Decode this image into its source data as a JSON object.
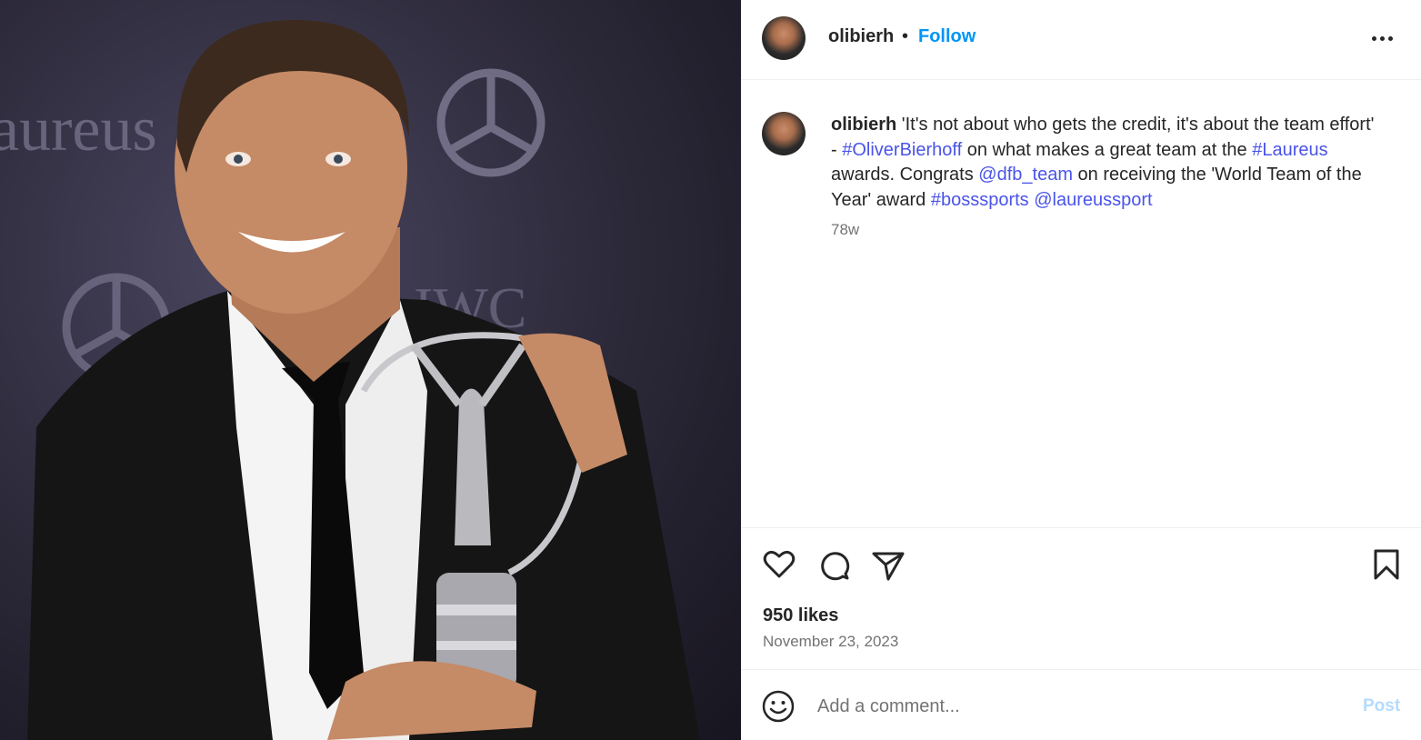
{
  "photo": {
    "description_icon": "award-photo",
    "backdrop_text": "aureus",
    "backdrop_brand": "IWC"
  },
  "header": {
    "username": "olibierh",
    "separator": "•",
    "follow_label": "Follow",
    "more_icon": "more-options-icon"
  },
  "caption": {
    "username": "olibierh",
    "text_1": " 'It's not about who gets the credit, it's about the team effort' - ",
    "tag_1": "#OliverBierhoff",
    "text_2": " on what makes a great team at the ",
    "tag_2": "#Laureus",
    "text_3": " awards. Congrats ",
    "mention_1": "@dfb_team",
    "text_4": " on receiving the 'World Team of the Year' award ",
    "tag_3": "#bosssports",
    "text_5": " ",
    "mention_2": "@laureussport",
    "time": "78w"
  },
  "actions": {
    "like_icon": "heart-icon",
    "comment_icon": "comment-icon",
    "share_icon": "share-icon",
    "save_icon": "bookmark-icon",
    "likes": "950 likes",
    "date": "November 23, 2023"
  },
  "comment": {
    "emoji_icon": "emoji-icon",
    "placeholder": "Add a comment...",
    "post_label": "Post"
  },
  "colors": {
    "link": "#4a54e8",
    "follow": "#0095f6",
    "post_disabled": "#b3dbff",
    "muted": "#737373"
  }
}
